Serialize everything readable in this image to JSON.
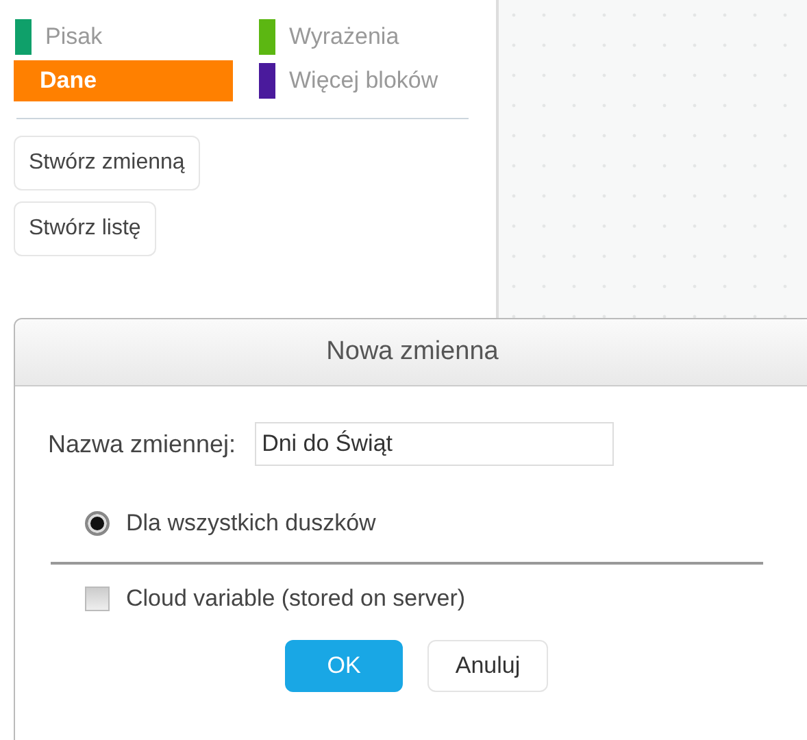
{
  "categories": [
    {
      "label": "Pisak",
      "color": "#0fa06a",
      "selected": false
    },
    {
      "label": "Wyrażenia",
      "color": "#5cb712",
      "selected": false
    },
    {
      "label": "Dane",
      "color": "#ff8000",
      "selected": true
    },
    {
      "label": "Więcej bloków",
      "color": "#4a1a9c",
      "selected": false
    }
  ],
  "palette_buttons": [
    "Stwórz zmienną",
    "Stwórz listę"
  ],
  "dialog": {
    "title": "Nowa zmienna",
    "name_label": "Nazwa zmiennej:",
    "name_value": "Dni do Świąt",
    "scope": {
      "label": "Dla wszystkich duszków",
      "selected": true
    },
    "cloud": {
      "label": "Cloud variable (stored on server)",
      "checked": false,
      "disabled": true
    },
    "buttons": [
      {
        "label": "OK",
        "kind": "primary"
      },
      {
        "label": "Anuluj",
        "kind": "secondary"
      }
    ]
  }
}
